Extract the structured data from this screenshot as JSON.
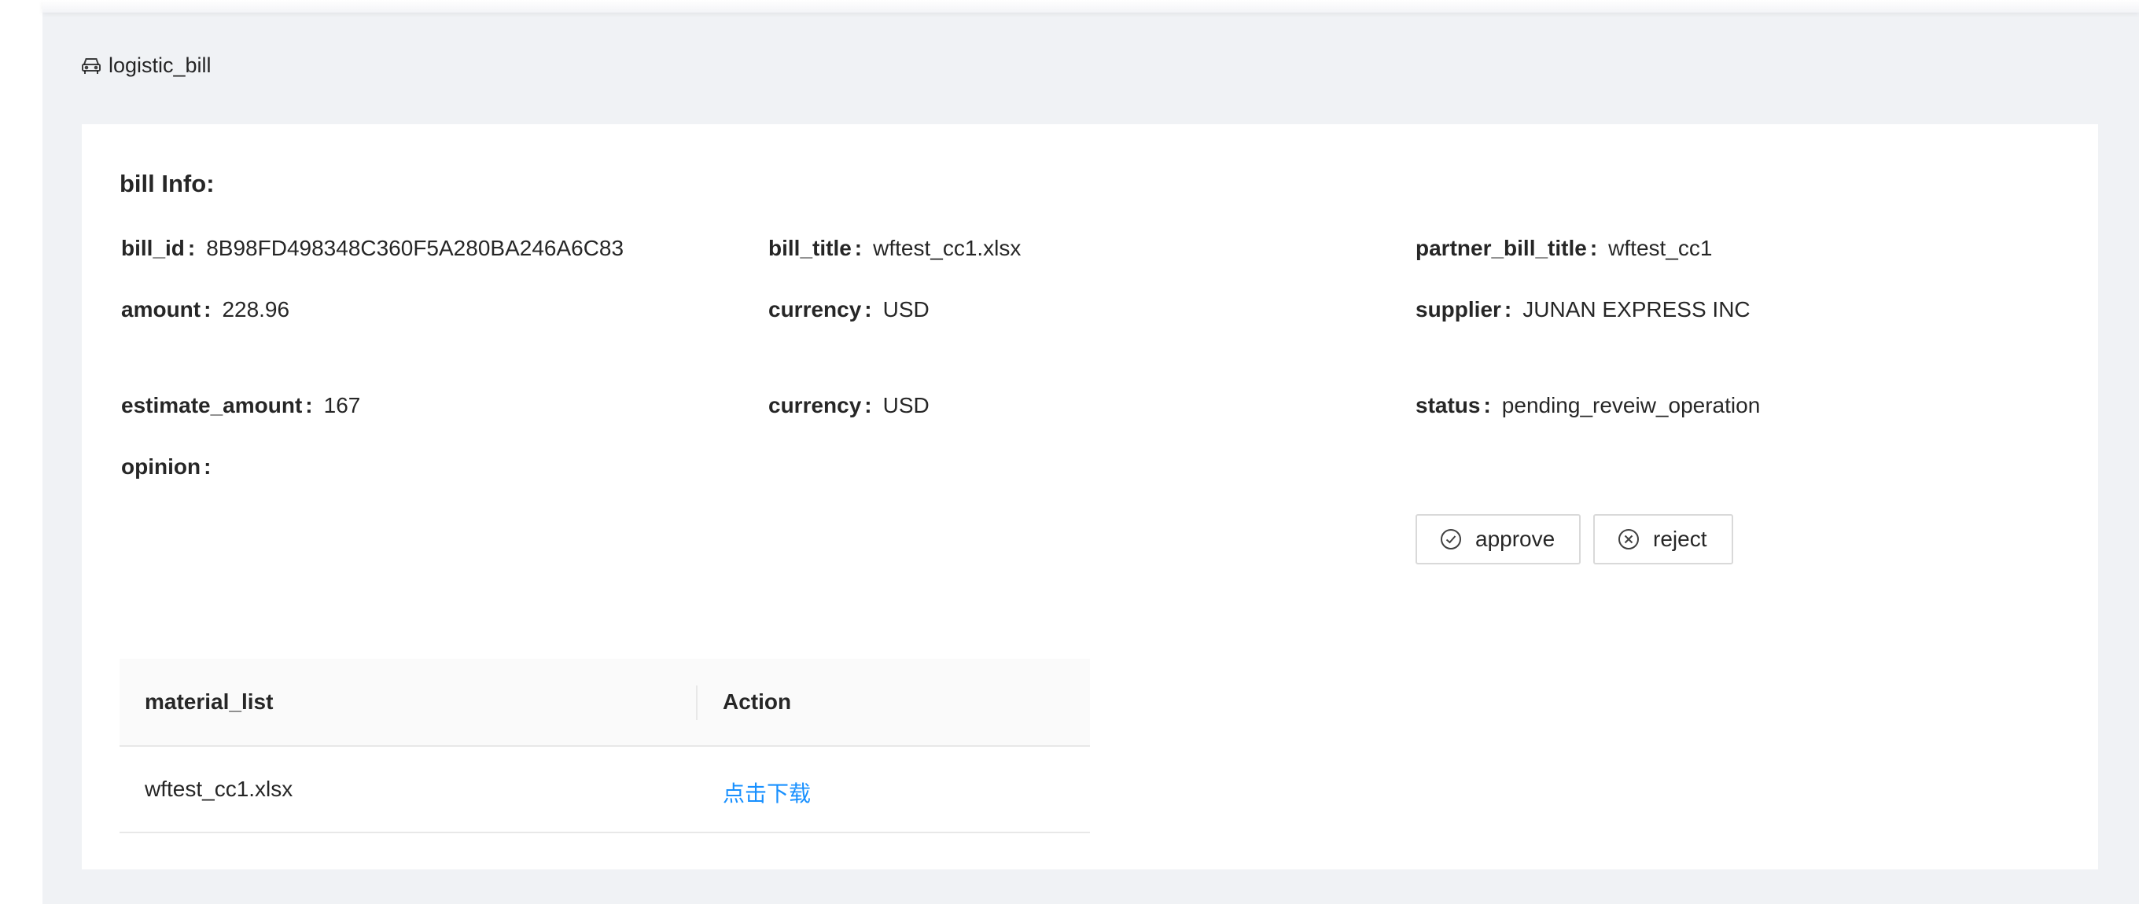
{
  "breadcrumb": {
    "icon": "car-icon",
    "label": "logistic_bill"
  },
  "card": {
    "title": "bill Info:"
  },
  "fields": {
    "bill_id": {
      "label": "bill_id",
      "value": "8B98FD498348C360F5A280BA246A6C83"
    },
    "bill_title": {
      "label": "bill_title",
      "value": "wftest_cc1.xlsx"
    },
    "partner_bill_title": {
      "label": "partner_bill_title",
      "value": "wftest_cc1"
    },
    "amount": {
      "label": "amount",
      "value": "228.96"
    },
    "currency1": {
      "label": "currency",
      "value": "USD"
    },
    "supplier": {
      "label": "supplier",
      "value": "JUNAN EXPRESS INC"
    },
    "estimate_amount": {
      "label": "estimate_amount",
      "value": "167"
    },
    "currency2": {
      "label": "currency",
      "value": "USD"
    },
    "status": {
      "label": "status",
      "value": "pending_reveiw_operation"
    },
    "opinion": {
      "label": "opinion",
      "value": ""
    },
    "colon": ":"
  },
  "actions": {
    "approve_label": "approve",
    "reject_label": "reject"
  },
  "table": {
    "headers": [
      "material_list",
      "Action"
    ],
    "rows": [
      {
        "material": "wftest_cc1.xlsx",
        "action": "点击下载"
      }
    ]
  },
  "colors": {
    "link": "#1890ff",
    "background": "#f0f2f5",
    "card": "#ffffff",
    "border": "#d9d9d9"
  }
}
